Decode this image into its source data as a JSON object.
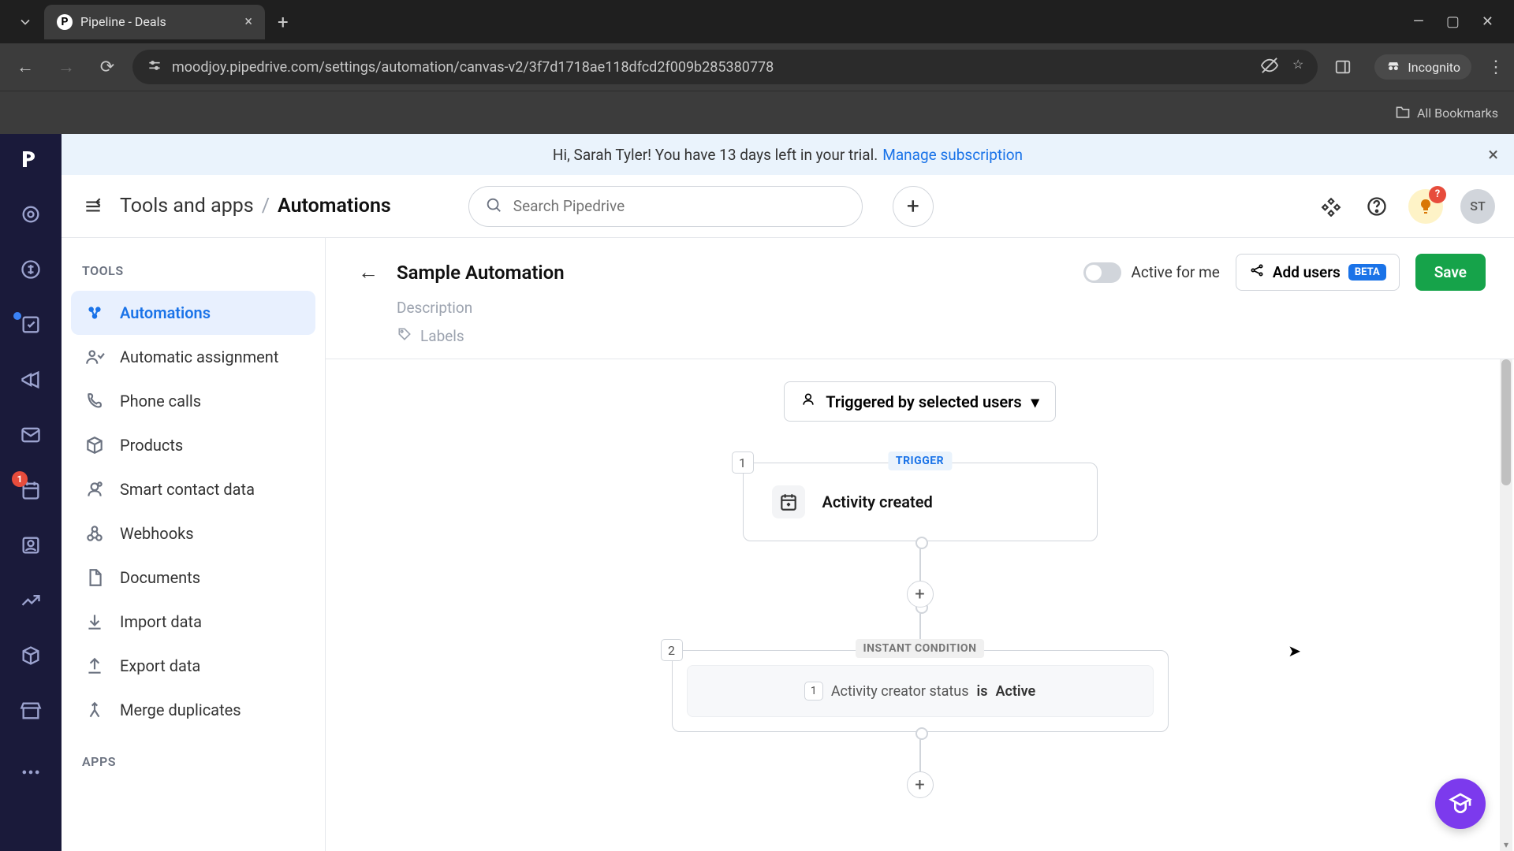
{
  "browser": {
    "tab_title": "Pipeline - Deals",
    "tab_favicon": "P",
    "url": "moodjoy.pipedrive.com/settings/automation/canvas-v2/3f7d1718ae118dfcd2f009b285380778",
    "incognito": "Incognito",
    "all_bookmarks": "All Bookmarks"
  },
  "trial": {
    "text": "Hi, Sarah Tyler! You have 13 days left in your trial.",
    "link": "Manage subscription"
  },
  "header": {
    "breadcrumb_root": "Tools and apps",
    "breadcrumb_current": "Automations",
    "search_placeholder": "Search Pipedrive",
    "bulb_badge": "?",
    "avatar_initials": "ST"
  },
  "rail": {
    "badge_mail": "1"
  },
  "sidebar": {
    "section1": "TOOLS",
    "section2": "APPS",
    "items": [
      {
        "label": "Automations"
      },
      {
        "label": "Automatic assignment"
      },
      {
        "label": "Phone calls"
      },
      {
        "label": "Products"
      },
      {
        "label": "Smart contact data"
      },
      {
        "label": "Webhooks"
      },
      {
        "label": "Documents"
      },
      {
        "label": "Import data"
      },
      {
        "label": "Export data"
      },
      {
        "label": "Merge duplicates"
      }
    ]
  },
  "automation": {
    "title": "Sample Automation",
    "description_placeholder": "Description",
    "labels_placeholder": "Labels",
    "toggle_label": "Active for me",
    "add_users_label": "Add users",
    "beta": "BETA",
    "save": "Save",
    "trigger_select": "Triggered by selected users",
    "nodes": {
      "trigger_badge": "TRIGGER",
      "trigger_num": "1",
      "trigger_title": "Activity created",
      "cond_badge": "INSTANT CONDITION",
      "cond_num": "2",
      "cond_inner_num": "1",
      "cond_field": "Activity creator status",
      "cond_op": "is",
      "cond_value": "Active"
    }
  }
}
